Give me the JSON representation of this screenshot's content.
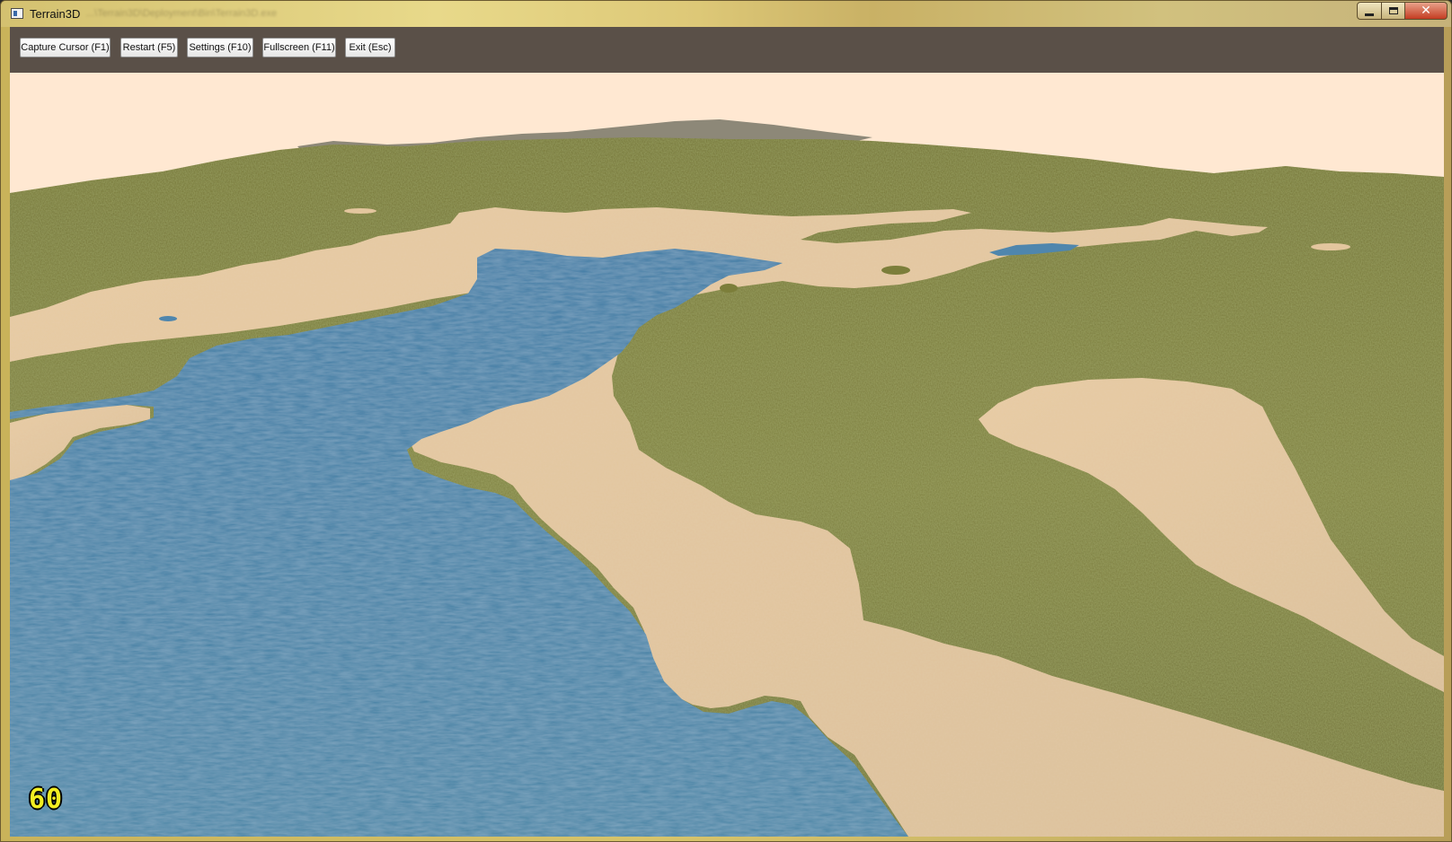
{
  "window": {
    "title": "Terrain3D",
    "path_text": "...\\Terrain3D\\Deployment\\Bin\\Terrain3D.exe",
    "minimize_icon": "minimize-icon",
    "maximize_icon": "maximize-icon",
    "close_icon": "close-icon",
    "close_glyph": "✕"
  },
  "toolbar": {
    "buttons": [
      {
        "label": "Capture Cursor (F1)"
      },
      {
        "label": "Restart (F5)"
      },
      {
        "label": "Settings (F10)"
      },
      {
        "label": "Fullscreen (F11)"
      },
      {
        "label": "Exit (Esc)"
      }
    ]
  },
  "scene": {
    "fps": "60",
    "colors": {
      "sky": "#ffe8d2",
      "grass": "#7c7e3a",
      "sand": "#e3c69e",
      "water": "#4a7fa1",
      "rock": "#8a8574",
      "fps_text": "#f2ee22"
    }
  }
}
